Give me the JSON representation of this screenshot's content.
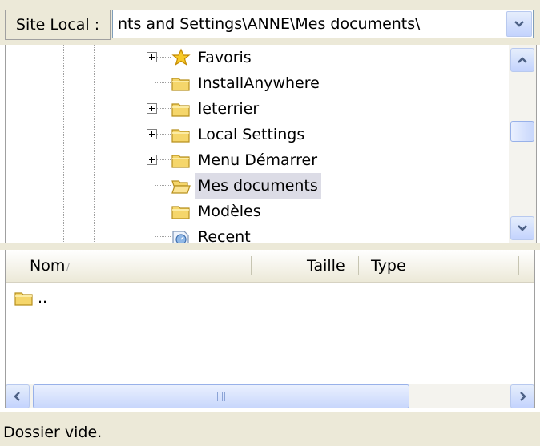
{
  "address_bar": {
    "label": "Site Local :",
    "path": "nts and Settings\\ANNE\\Mes documents\\"
  },
  "tree": {
    "items": [
      {
        "label": "Favoris",
        "icon": "star-folder-icon",
        "expandable": true,
        "selected": false
      },
      {
        "label": "InstallAnywhere",
        "icon": "folder-icon",
        "expandable": false,
        "selected": false
      },
      {
        "label": "leterrier",
        "icon": "folder-icon",
        "expandable": true,
        "selected": false
      },
      {
        "label": "Local Settings",
        "icon": "folder-icon",
        "expandable": true,
        "selected": false
      },
      {
        "label": "Menu Démarrer",
        "icon": "folder-icon",
        "expandable": true,
        "selected": false
      },
      {
        "label": "Mes documents",
        "icon": "open-folder-icon",
        "expandable": false,
        "selected": true
      },
      {
        "label": "Modèles",
        "icon": "folder-icon",
        "expandable": false,
        "selected": false
      },
      {
        "label": "Recent",
        "icon": "recent-folder-icon",
        "expandable": false,
        "selected": false
      }
    ]
  },
  "file_list": {
    "columns": [
      "Nom",
      "Taille",
      "Type"
    ],
    "sort_indicator": "/",
    "rows": [
      {
        "name": "..",
        "icon": "folder-icon"
      }
    ]
  },
  "status": {
    "text": "Dossier vide."
  },
  "colors": {
    "chrome": "#ece9d8",
    "selection": "#dcdce6",
    "folder": "#f5d66b",
    "scroll_button": "#c3d3fd"
  }
}
